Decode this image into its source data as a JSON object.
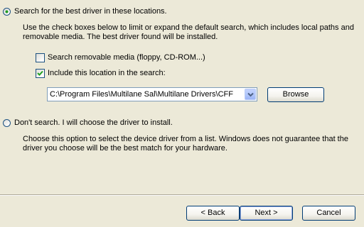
{
  "search_option": {
    "label": "Search for the best driver in these locations.",
    "selected": true
  },
  "search_description": "Use the check boxes below to limit or expand the default search, which includes local paths and removable media. The best driver found will be installed.",
  "removable_media": {
    "label": "Search removable media (floppy, CD-ROM...)",
    "checked": false
  },
  "include_location": {
    "label": "Include this location in the search:",
    "checked": true
  },
  "location_combo": {
    "value": "C:\\Program Files\\Multilane Sal\\Multilane Drivers\\CFF"
  },
  "browse_button": "Browse",
  "dont_search_option": {
    "label": "Don't search. I will choose the driver to install.",
    "selected": false
  },
  "dont_search_description": "Choose this option to select the device driver from a list.  Windows does not guarantee that the driver you choose will be the best match for your hardware.",
  "footer": {
    "back": "< Back",
    "next": "Next >",
    "cancel": "Cancel"
  },
  "colors": {
    "dialog_bg": "#ece9d8",
    "radio_selected": "#21a121",
    "checkmark": "#21a121",
    "border_blue": "#1c5180"
  }
}
